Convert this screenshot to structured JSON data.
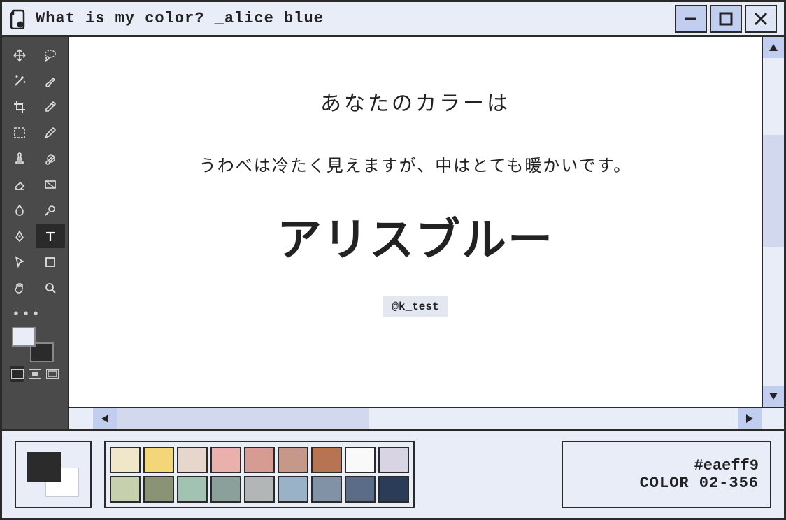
{
  "titlebar": {
    "title": "What is my color? _alice blue"
  },
  "canvas": {
    "heading": "あなたのカラーは",
    "description": "うわべは冷たく見えますが、中はとても暖かいです。",
    "color_name": "アリスブルー",
    "handle": "@k_test"
  },
  "info": {
    "hex": "#eaeff9",
    "code": "COLOR 02-356"
  },
  "palette": [
    "#f0e6c8",
    "#f2d678",
    "#e6d6cc",
    "#e9b0ac",
    "#d69c94",
    "#c6988a",
    "#b87452",
    "#f9f9f9",
    "#d8d4e4",
    "#c6d0ac",
    "#8a9474",
    "#a2c2b2",
    "#8aa09a",
    "#b2b6b6",
    "#9ab2c8",
    "#8292a6",
    "#5a6c88",
    "#2a3c58"
  ],
  "tools": [
    {
      "name": "move-icon"
    },
    {
      "name": "lasso-icon"
    },
    {
      "name": "wand-icon"
    },
    {
      "name": "brush-icon"
    },
    {
      "name": "crop-icon"
    },
    {
      "name": "eyedropper-icon"
    },
    {
      "name": "marquee-icon"
    },
    {
      "name": "pencil-icon"
    },
    {
      "name": "stamp-icon"
    },
    {
      "name": "history-brush-icon"
    },
    {
      "name": "eraser-icon"
    },
    {
      "name": "gradient-icon"
    },
    {
      "name": "blur-icon"
    },
    {
      "name": "dodge-icon"
    },
    {
      "name": "pen-icon"
    },
    {
      "name": "text-icon",
      "selected": true
    },
    {
      "name": "pointer-icon"
    },
    {
      "name": "shape-icon"
    },
    {
      "name": "hand-icon"
    },
    {
      "name": "zoom-icon"
    }
  ]
}
